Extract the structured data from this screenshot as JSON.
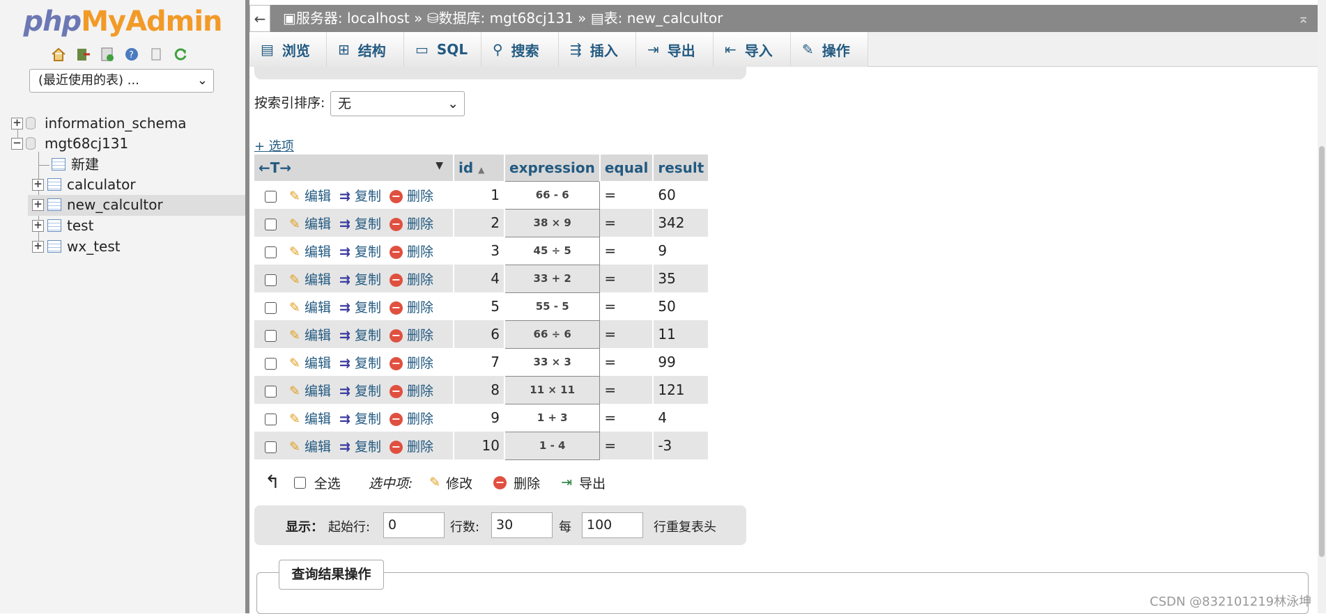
{
  "logo": {
    "php": "php",
    "my": "My",
    "admin": "Admin"
  },
  "left": {
    "recent_select": "(最近使用的表) ...",
    "databases": [
      "information_schema",
      "mgt68cj131"
    ],
    "tree_items": [
      "新建",
      "calculator",
      "new_calcultor",
      "test",
      "wx_test"
    ]
  },
  "breadcrumb": {
    "server": "服务器: localhost »",
    "database": "数据库: mgt68cj131 »",
    "table": "表: new_calcultor"
  },
  "tabs": [
    "浏览",
    "结构",
    "SQL",
    "搜索",
    "插入",
    "导出",
    "导入",
    "操作"
  ],
  "sort": {
    "label": "按索引排序:",
    "value": "无"
  },
  "options_link": "+ 选项",
  "table": {
    "arrows": "←T→",
    "columns": [
      "id",
      "expression",
      "equal",
      "result"
    ],
    "actions": {
      "edit": "编辑",
      "copy": "复制",
      "delete": "删除"
    },
    "rows": [
      {
        "id": "1",
        "expression": "66 - 6",
        "equal": "=",
        "result": "60"
      },
      {
        "id": "2",
        "expression": "38 × 9",
        "equal": "=",
        "result": "342"
      },
      {
        "id": "3",
        "expression": "45 ÷ 5",
        "equal": "=",
        "result": "9"
      },
      {
        "id": "4",
        "expression": "33 + 2",
        "equal": "=",
        "result": "35"
      },
      {
        "id": "5",
        "expression": "55 - 5",
        "equal": "=",
        "result": "50"
      },
      {
        "id": "6",
        "expression": "66 ÷ 6",
        "equal": "=",
        "result": "11"
      },
      {
        "id": "7",
        "expression": "33 × 3",
        "equal": "=",
        "result": "99"
      },
      {
        "id": "8",
        "expression": "11 × 11",
        "equal": "=",
        "result": "121"
      },
      {
        "id": "9",
        "expression": "1 + 3",
        "equal": "=",
        "result": "4"
      },
      {
        "id": "10",
        "expression": "1 - 4",
        "equal": "=",
        "result": "-3"
      }
    ]
  },
  "bulk": {
    "select_all": "全选",
    "with_selected": "选中项:",
    "edit": "修改",
    "delete": "删除",
    "export": "导出"
  },
  "display": {
    "label": "显示：",
    "start_label": "起始行:",
    "start": "0",
    "rows_label": "行数:",
    "rows": "30",
    "every_label": "每",
    "every": "100",
    "repeat_label": "行重复表头"
  },
  "query_ops": "查询结果操作",
  "watermark": "CSDN @832101219林泳坤"
}
